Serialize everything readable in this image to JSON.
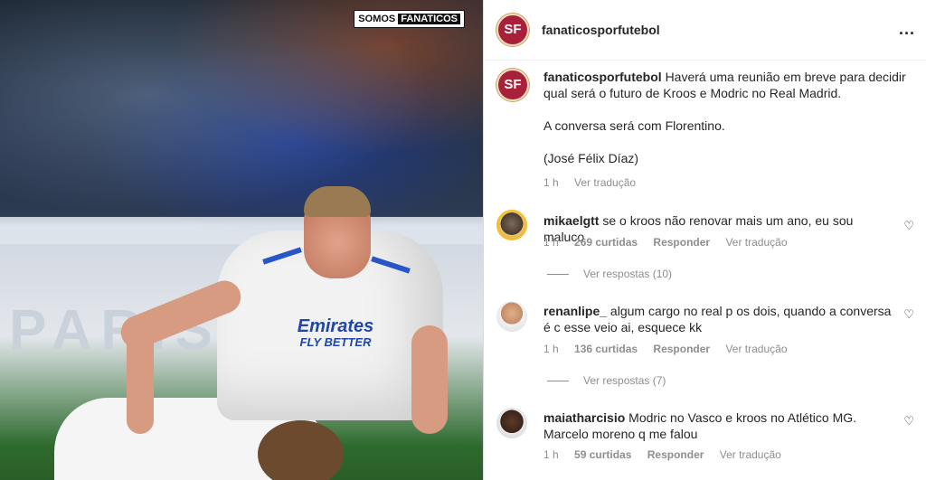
{
  "photo": {
    "brand_left": "SOMOS",
    "brand_right": "FANATICOS",
    "ad_text": "PARIS",
    "shirt_sponsor": "Emirates",
    "shirt_sponsor_sub": "FLY BETTER"
  },
  "header": {
    "avatar_text": "SF",
    "username": "fanaticosporfutebol",
    "more_icon": "..."
  },
  "caption": {
    "avatar_text": "SF",
    "username": "fanaticosporfutebol",
    "text": "Haverá uma reunião em breve para decidir qual será o futuro de Kroos e Modric no Real Madrid.",
    "para2": "A conversa será com Florentino.",
    "para3": "(José Félix Díaz)",
    "time": "1 h",
    "translate": "Ver tradução"
  },
  "comments": [
    {
      "username": "mikaelgtt",
      "text": "se o kroos não renovar mais um ano, eu sou maluco",
      "time": "1 h",
      "likes": "269 curtidas",
      "reply": "Responder",
      "translate": "Ver tradução",
      "replies": "Ver respostas (10)"
    },
    {
      "username": "renanlipe_",
      "text": "algum cargo no real p os dois, quando a conversa é c esse veio ai, esquece kk",
      "time": "1 h",
      "likes": "136 curtidas",
      "reply": "Responder",
      "translate": "Ver tradução",
      "replies": "Ver respostas (7)"
    },
    {
      "username": "maiatharcisio",
      "text": "Modric no Vasco e kroos no Atlético MG. Marcelo moreno q me falou",
      "time": "1 h",
      "likes": "59 curtidas",
      "reply": "Responder",
      "translate": "Ver tradução"
    }
  ],
  "icons": {
    "heart": "heart-outline-icon",
    "more": "more-horizontal-icon"
  }
}
